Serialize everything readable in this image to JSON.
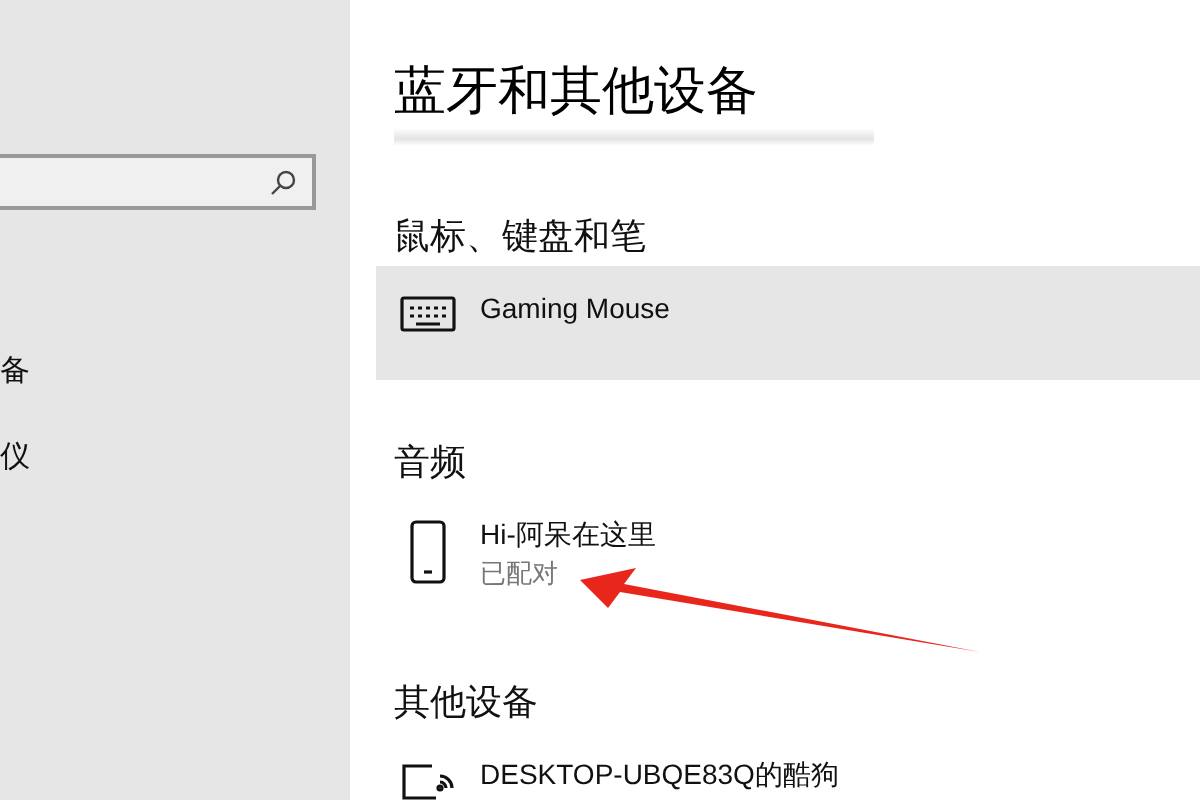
{
  "sidebar": {
    "items": [
      {
        "label": "备"
      },
      {
        "label": "仪"
      }
    ]
  },
  "page": {
    "title": "蓝牙和其他设备",
    "sections": [
      {
        "heading": "鼠标、键盘和笔",
        "devices": [
          {
            "kind": "keyboard",
            "name": "Gaming Mouse",
            "selected": true
          }
        ]
      },
      {
        "heading": "音频",
        "devices": [
          {
            "kind": "phone",
            "name": "Hi-阿呆在这里",
            "status": "已配对",
            "selected": false
          }
        ]
      },
      {
        "heading": "其他设备",
        "devices": [
          {
            "kind": "display",
            "name": "DESKTOP-UBQE83Q的酷狗",
            "selected": false
          }
        ]
      }
    ]
  }
}
